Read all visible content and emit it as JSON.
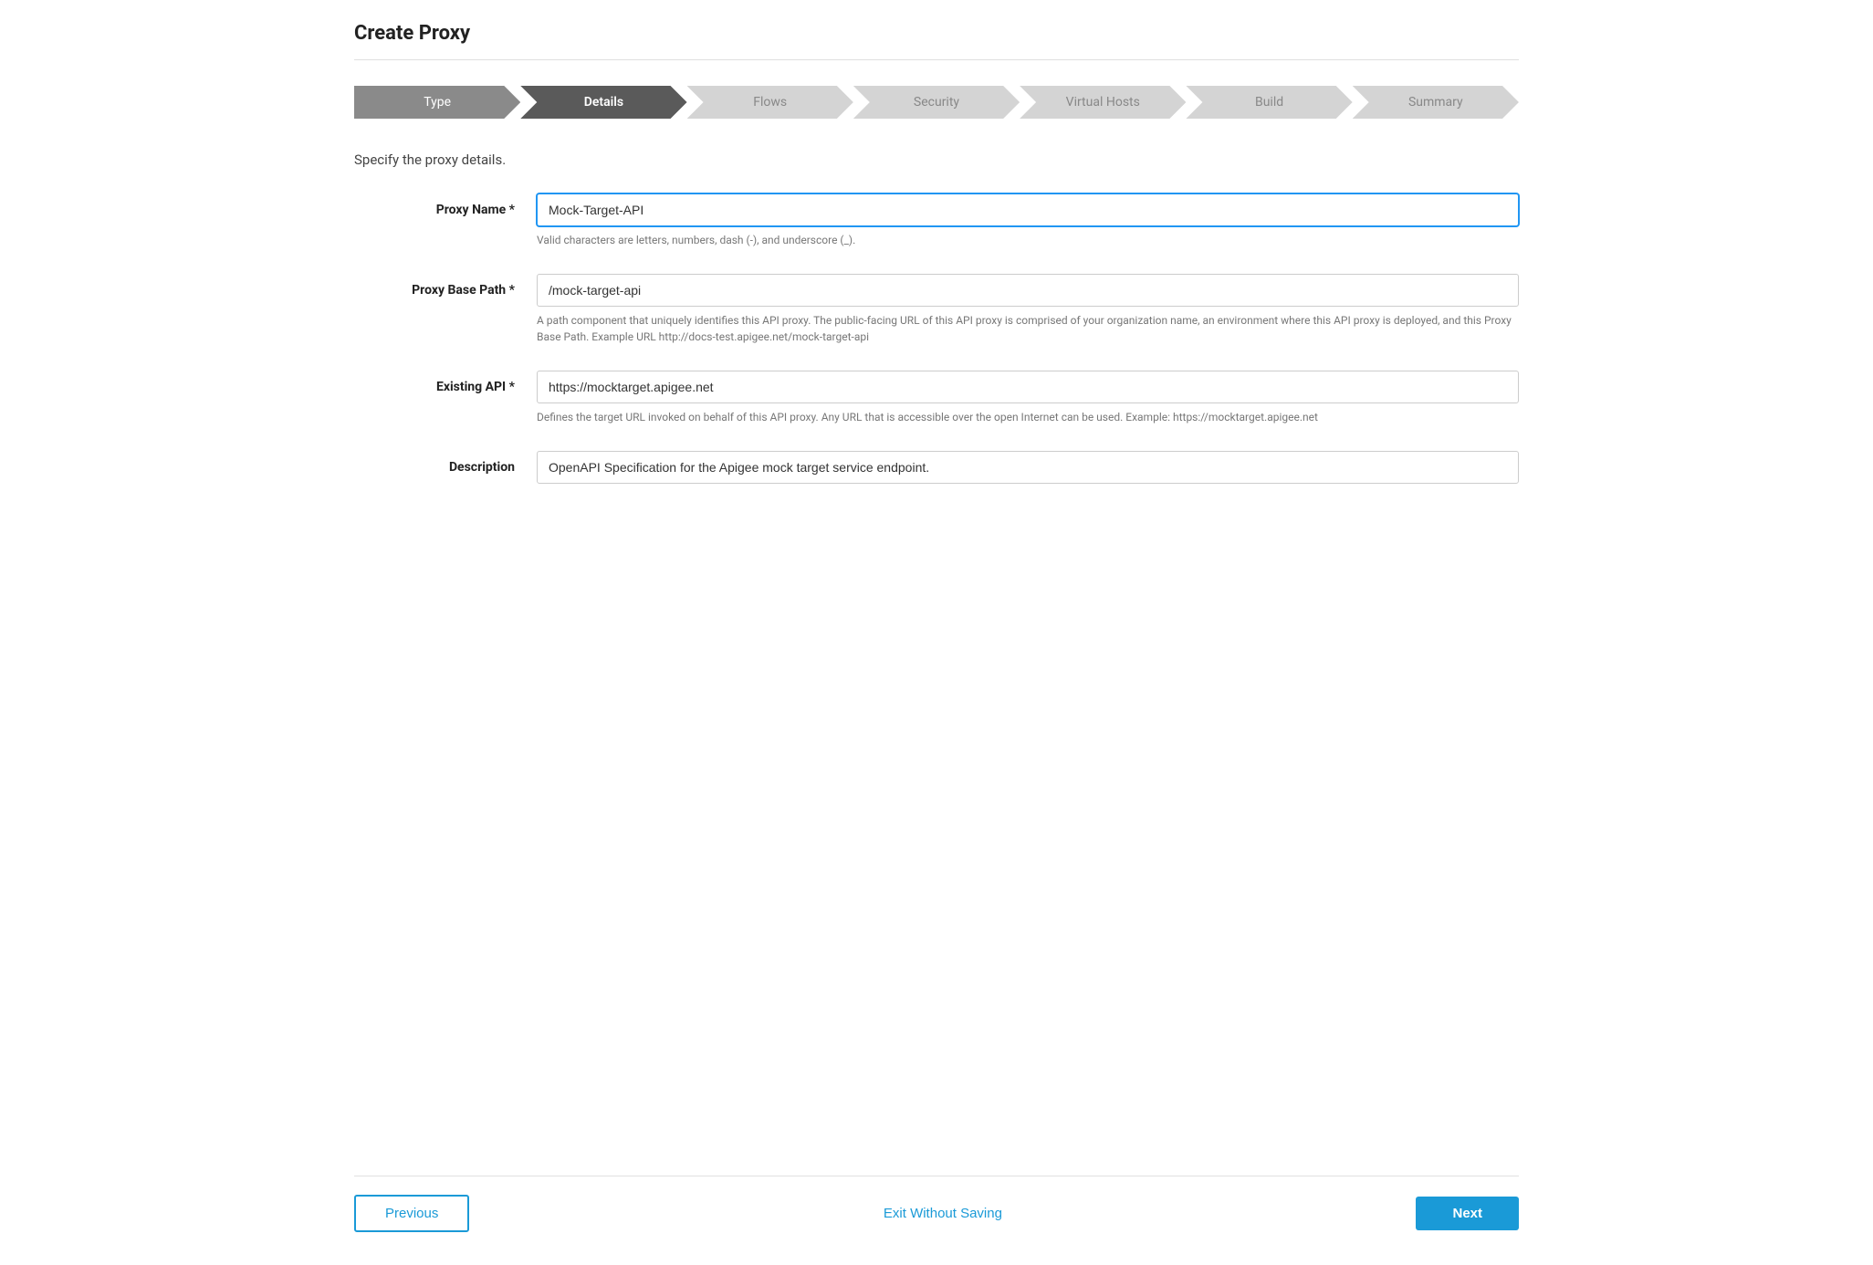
{
  "page": {
    "title": "Create Proxy"
  },
  "stepper": {
    "steps": [
      {
        "id": "type",
        "label": "Type",
        "state": "completed"
      },
      {
        "id": "details",
        "label": "Details",
        "state": "active"
      },
      {
        "id": "flows",
        "label": "Flows",
        "state": "inactive"
      },
      {
        "id": "security",
        "label": "Security",
        "state": "inactive"
      },
      {
        "id": "virtual-hosts",
        "label": "Virtual Hosts",
        "state": "inactive"
      },
      {
        "id": "build",
        "label": "Build",
        "state": "inactive"
      },
      {
        "id": "summary",
        "label": "Summary",
        "state": "inactive"
      }
    ]
  },
  "form": {
    "subtitle": "Specify the proxy details.",
    "fields": {
      "proxy_name": {
        "label": "Proxy Name",
        "required": true,
        "value": "Mock-Target-API",
        "hint": "Valid characters are letters, numbers, dash (-), and underscore (_)."
      },
      "proxy_base_path": {
        "label": "Proxy Base Path",
        "required": true,
        "value": "/mock-target-api",
        "hint": "A path component that uniquely identifies this API proxy. The public-facing URL of this API proxy is comprised of your organization name, an environment where this API proxy is deployed, and this Proxy Base Path. Example URL http://docs-test.apigee.net/mock-target-api"
      },
      "existing_api": {
        "label": "Existing API",
        "required": true,
        "value": "https://mocktarget.apigee.net",
        "hint": "Defines the target URL invoked on behalf of this API proxy. Any URL that is accessible over the open Internet can be used. Example: https://mocktarget.apigee.net"
      },
      "description": {
        "label": "Description",
        "required": false,
        "value": "OpenAPI Specification for the Apigee mock target service endpoint.",
        "hint": ""
      }
    }
  },
  "footer": {
    "previous_label": "Previous",
    "exit_label": "Exit Without Saving",
    "next_label": "Next"
  }
}
